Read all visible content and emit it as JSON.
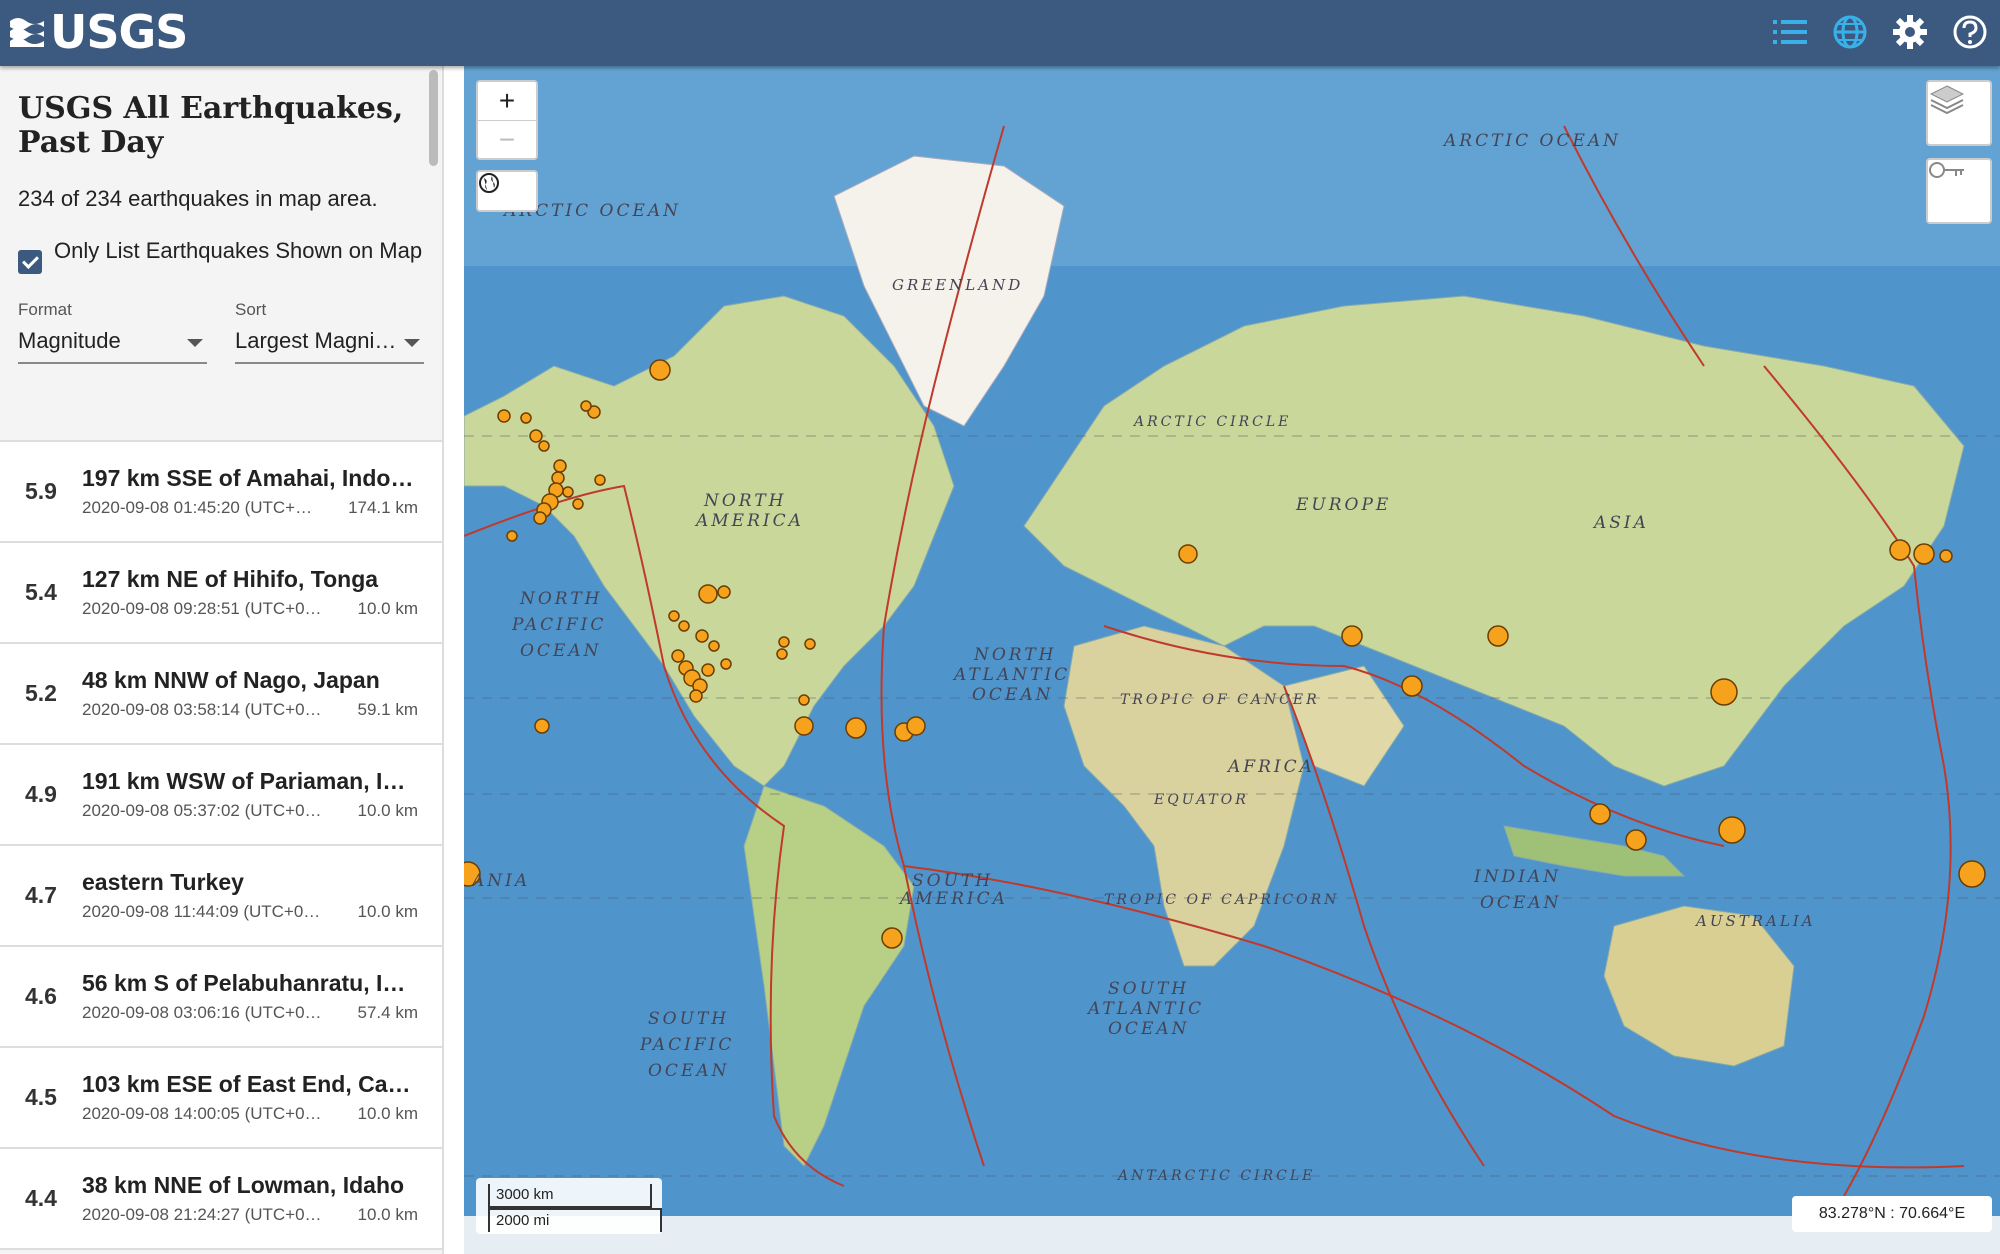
{
  "header": {
    "logo_text": "USGS"
  },
  "sidebar": {
    "title": "USGS All Earthquakes, Past Day",
    "count": "234 of 234 earthquakes in map area.",
    "only_list_label": "Only List Earthquakes Shown on Map",
    "format_label": "Format",
    "format_value": "Magnitude",
    "sort_label": "Sort",
    "sort_value": "Largest Magni…",
    "earthquakes": [
      {
        "mag": "5.9",
        "place": "197 km SSE of Amahai, Indon…",
        "time": "2020-09-08 01:45:20 (UTC+…",
        "depth": "174.1 km"
      },
      {
        "mag": "5.4",
        "place": "127 km NE of Hihifo, Tonga",
        "time": "2020-09-08 09:28:51 (UTC+0…",
        "depth": "10.0 km"
      },
      {
        "mag": "5.2",
        "place": "48 km NNW of Nago, Japan",
        "time": "2020-09-08 03:58:14 (UTC+0…",
        "depth": "59.1 km"
      },
      {
        "mag": "4.9",
        "place": "191 km WSW of Pariaman, In…",
        "time": "2020-09-08 05:37:02 (UTC+0…",
        "depth": "10.0 km"
      },
      {
        "mag": "4.7",
        "place": "eastern Turkey",
        "time": "2020-09-08 11:44:09 (UTC+0…",
        "depth": "10.0 km"
      },
      {
        "mag": "4.6",
        "place": "56 km S of Pelabuhanratu, In…",
        "time": "2020-09-08 03:06:16 (UTC+0…",
        "depth": "57.4 km"
      },
      {
        "mag": "4.5",
        "place": "103 km ESE of East End, Cay…",
        "time": "2020-09-08 14:00:05 (UTC+0…",
        "depth": "10.0 km"
      },
      {
        "mag": "4.4",
        "place": "38 km NNE of Lowman, Idaho",
        "time": "2020-09-08 21:24:27 (UTC+0…",
        "depth": "10.0 km"
      }
    ]
  },
  "map": {
    "zoom_in": "+",
    "zoom_out": "−",
    "scale_km": "3000 km",
    "scale_mi": "2000 mi",
    "coords": "83.278°N : 70.664°E",
    "labels": {
      "arctic_ocean_w": "ARCTIC OCEAN",
      "arctic_ocean_e": "ARCTIC OCEAN",
      "greenland": "GREENLAND",
      "arctic_circle": "ARCTIC CIRCLE",
      "north_america_1": "NORTH",
      "north_america_2": "AMERICA",
      "europe": "EUROPE",
      "asia": "ASIA",
      "north_pacific_1": "NORTH",
      "north_pacific_2": "PACIFIC",
      "north_pacific_3": "OCEAN",
      "north_atlantic_1": "NORTH",
      "north_atlantic_2": "ATLANTIC",
      "north_atlantic_3": "OCEAN",
      "tropic_cancer": "TROPIC OF CANCER",
      "africa": "AFRICA",
      "equator": "EQUATOR",
      "south_america_1": "SOUTH",
      "south_america_2": "AMERICA",
      "tropic_capricorn": "TROPIC OF CAPRICORN",
      "indian_ocean_1": "INDIAN",
      "indian_ocean_2": "OCEAN",
      "australia": "AUSTRALIA",
      "south_pacific_1": "SOUTH",
      "south_pacific_2": "PACIFIC",
      "south_pacific_3": "OCEAN",
      "south_atlantic_1": "SOUTH",
      "south_atlantic_2": "ATLANTIC",
      "south_atlantic_3": "OCEAN",
      "antarctic_circle": "ANTARCTIC CIRCLE",
      "oceania_left": "ANIA"
    },
    "colors": {
      "ocean": "#4f95cc",
      "land": "#c9d79a",
      "plate": "#c0392b",
      "quake": "#f6a21c",
      "header": "#3c5a80"
    }
  }
}
